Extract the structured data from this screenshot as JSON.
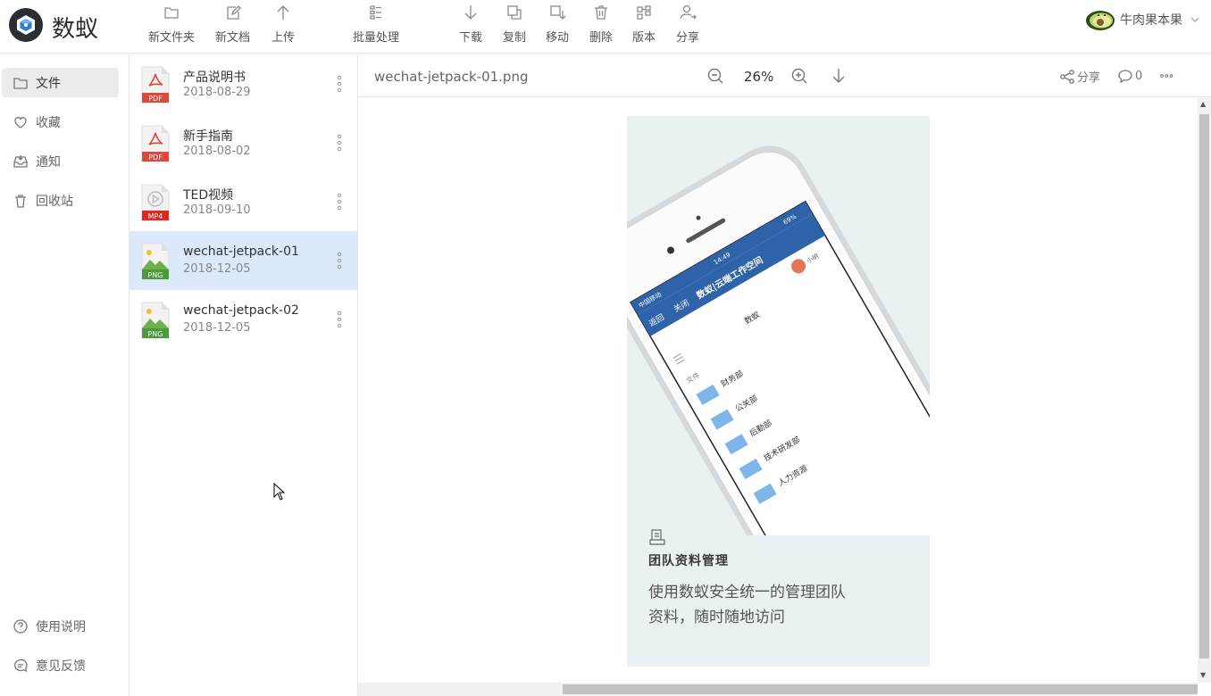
{
  "app": {
    "name": "数蚁"
  },
  "toolbar": {
    "new_folder": "新文件夹",
    "new_doc": "新文档",
    "upload": "上传",
    "batch": "批量处理",
    "download": "下载",
    "copy": "复制",
    "move": "移动",
    "delete": "删除",
    "version": "版本",
    "share": "分享"
  },
  "user": {
    "name": "牛肉果本果"
  },
  "nav": {
    "files": "文件",
    "favorites": "收藏",
    "notifications": "通知",
    "trash": "回收站",
    "help": "使用说明",
    "feedback": "意见反馈"
  },
  "files": [
    {
      "name": "产品说明书",
      "date": "2018-08-29",
      "type": "PDF"
    },
    {
      "name": "新手指南",
      "date": "2018-08-02",
      "type": "PDF"
    },
    {
      "name": "TED视频",
      "date": "2018-09-10",
      "type": "MP4"
    },
    {
      "name": "wechat-jetpack-01",
      "date": "2018-12-05",
      "type": "PNG"
    },
    {
      "name": "wechat-jetpack-02",
      "date": "2018-12-05",
      "type": "PNG"
    }
  ],
  "preview": {
    "filename": "wechat-jetpack-01.png",
    "zoom": "26%",
    "share_label": "分享",
    "comment_count": "0"
  },
  "image": {
    "phone": {
      "status_time": "14:49",
      "carrier": "中国移动",
      "battery": "69%",
      "back": "返回",
      "close": "关闭",
      "title": "数蚁|云端工作空间",
      "user": "小明",
      "header": "数蚁",
      "crumb": "文件",
      "folders": [
        "财务部",
        "公关部",
        "后勤部",
        "技术研发部",
        "人力资源"
      ]
    },
    "card_title": "团队资料管理",
    "card_line1": "使用数蚁安全统一的管理团队",
    "card_line2": "资料，随时随地访问"
  },
  "colors": {
    "accent": "#2f63a9",
    "selected_row": "#dbe9fb",
    "pdf_badge": "#d94a3d",
    "mp4_badge": "#e0281e",
    "png_badge": "#4c9a3c",
    "card_bg": "#eaf1f2"
  }
}
